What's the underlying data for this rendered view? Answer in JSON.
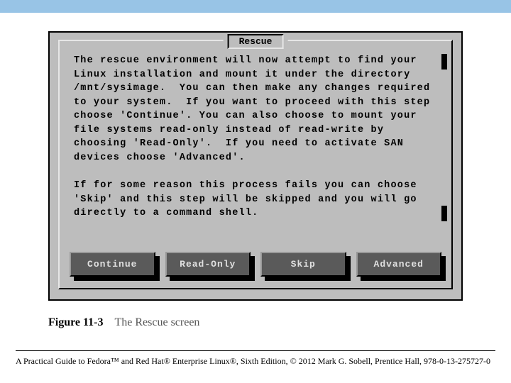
{
  "dialog": {
    "title": "Rescue",
    "paragraph1": "The rescue environment will now attempt to find your Linux installation and mount it under the directory /mnt/sysimage.  You can then make any changes required to your system.  If you want to proceed with this step choose 'Continue'. You can also choose to mount your file systems read-only instead of read-write by choosing 'Read-Only'.  If you need to activate SAN devices choose 'Advanced'.",
    "paragraph2": "If for some reason this process fails you can choose 'Skip' and this step will be skipped and you will go directly to a command shell.",
    "buttons": {
      "continue": "Continue",
      "readonly": "Read-Only",
      "skip": "Skip",
      "advanced": "Advanced"
    }
  },
  "caption": {
    "label": "Figure 11-3",
    "text": "The Rescue screen"
  },
  "credit": "A Practical Guide to Fedora™ and Red Hat® Enterprise Linux®, Sixth Edition, © 2012 Mark G. Sobell, Prentice Hall, 978-0-13-275727-0"
}
